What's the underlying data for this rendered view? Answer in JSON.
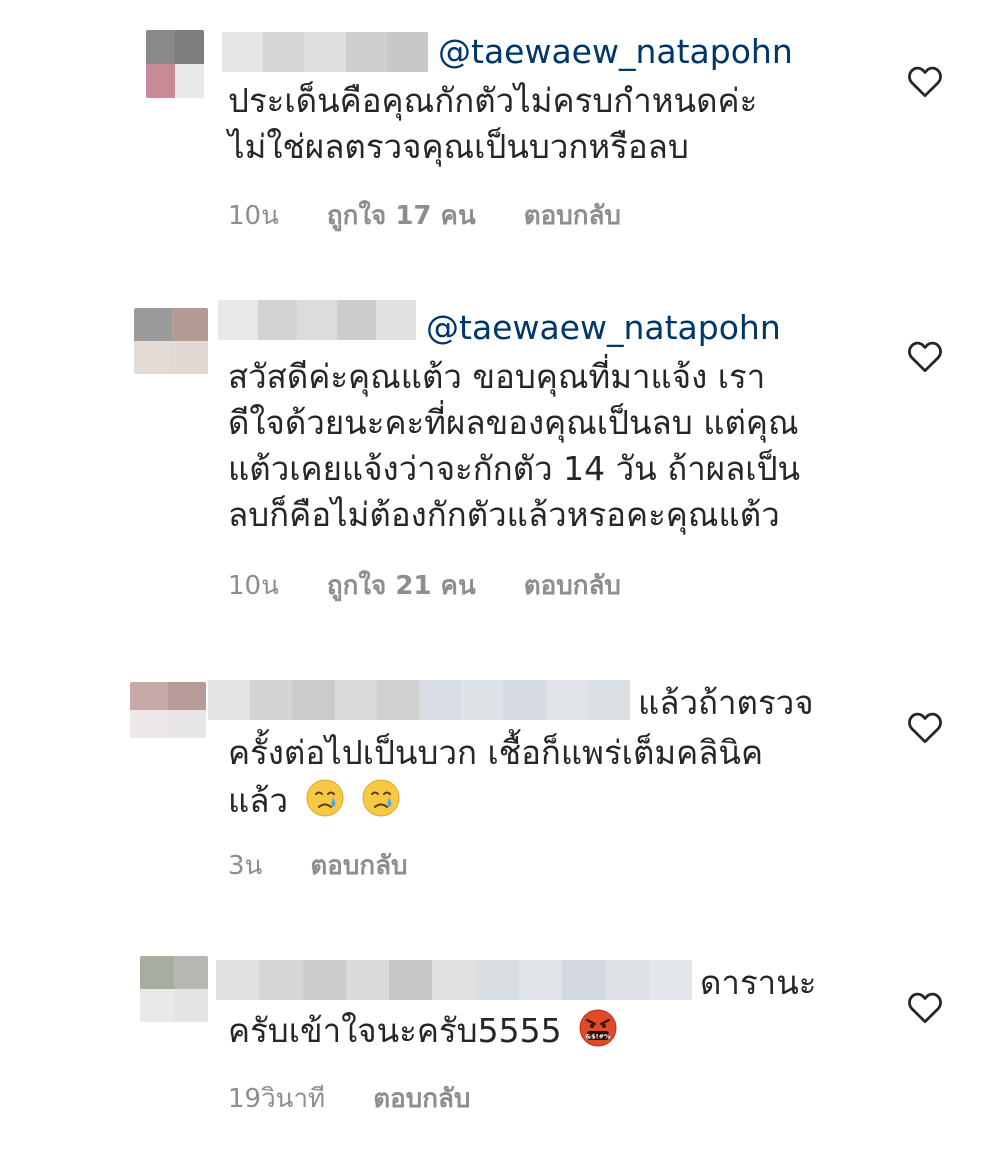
{
  "comments": [
    {
      "mention": "@taewaew_natapohn",
      "lines": [
        "ประเด็นคือคุณกักตัวไม่ครบกำหนดค่ะ",
        "ไม่ใช่ผลตรวจคุณเป็นบวกหรือลบ"
      ],
      "time": "10น",
      "likes": "ถูกใจ 17 คน",
      "reply": "ตอบกลับ"
    },
    {
      "mention": "@taewaew_natapohn",
      "lines": [
        "สวัสดีค่ะคุณแต้ว ขอบคุณที่มาแจ้ง เรา",
        "ดีใจด้วยนะคะที่ผลของคุณเป็นลบ แต่คุณ",
        "แต้วเคยแจ้งว่าจะกักตัว 14 วัน ถ้าผลเป็น",
        "ลบก็คือไม่ต้องกักตัวแล้วหรอคะคุณแต้ว"
      ],
      "time": "10น",
      "likes": "ถูกใจ 21 คน",
      "reply": "ตอบกลับ"
    },
    {
      "lines": [
        "แล้วถ้าตรวจ",
        "ครั้งต่อไปเป็นบวก เชื้อก็แพร่เต็มคลินิค",
        "แล้ว"
      ],
      "time": "3น",
      "reply": "ตอบกลับ"
    },
    {
      "lines": [
        "ดารานะ",
        "ครับเข้าใจนะครับ5555"
      ],
      "time": "19วินาที",
      "reply": "ตอบกลับ"
    }
  ],
  "colors": {
    "text": "#262626",
    "mention": "#00376b",
    "meta": "#8e8e8e",
    "heart": "#262626"
  },
  "icons": [
    "heart-outline-icon",
    "crying-face-emoji",
    "cursing-face-emoji"
  ]
}
